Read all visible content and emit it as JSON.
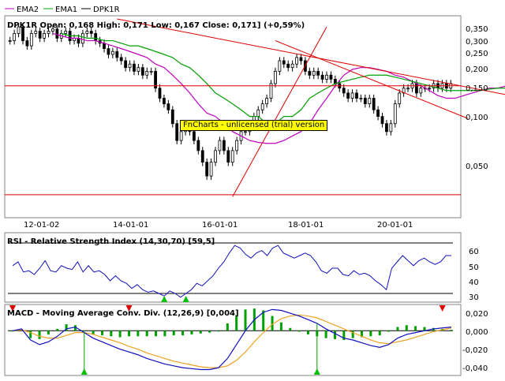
{
  "window": {
    "background": "#ffffff",
    "frame_color": "#808080"
  },
  "legend": [
    {
      "name": "EMA2",
      "color": "#c000c0"
    },
    {
      "name": "EMA1",
      "color": "#00a000"
    },
    {
      "name": "DPK1R",
      "color": "#000000"
    }
  ],
  "price_panel": {
    "header": "DPK1R  Open: 0,168  High: 0,171  Low: 0,167  Close: 0,171] (+0,59%)",
    "y_ticks": [
      "0,350",
      "0,300",
      "0,250",
      "0,200",
      "0,150",
      "0,100",
      "0,050"
    ],
    "x_ticks": [
      "12-01-02",
      "14-01-01",
      "16-01-01",
      "18-01-01",
      "20-01-01"
    ],
    "watermark": "FnCharts - unlicensed (trial) version"
  },
  "rsi_panel": {
    "title": "RSI - Relative Strength Index (14,30,70) [59,5]",
    "y_ticks": [
      "60",
      "50",
      "40",
      "30"
    ]
  },
  "macd_panel": {
    "title": "MACD - Moving Average Conv. Div. (12,26,9) [0,004]",
    "y_ticks": [
      "0,020",
      "0,000",
      "-0,020",
      "-0,040"
    ]
  },
  "chart_data": [
    {
      "type": "candlestick",
      "name": "DPK1R",
      "scale": "log",
      "ylim": [
        0.03,
        0.4
      ],
      "x_tick_labels": [
        "12-01-02",
        "14-01-01",
        "16-01-01",
        "18-01-01",
        "20-01-01"
      ],
      "x_tick_index": [
        5,
        26,
        47,
        68,
        89
      ],
      "close": [
        0.3,
        0.33,
        0.36,
        0.3,
        0.28,
        0.33,
        0.34,
        0.31,
        0.33,
        0.34,
        0.35,
        0.31,
        0.33,
        0.34,
        0.3,
        0.31,
        0.29,
        0.33,
        0.34,
        0.33,
        0.3,
        0.29,
        0.27,
        0.25,
        0.26,
        0.24,
        0.23,
        0.21,
        0.22,
        0.2,
        0.21,
        0.19,
        0.2,
        0.2,
        0.16,
        0.14,
        0.13,
        0.12,
        0.1,
        0.08,
        0.09,
        0.1,
        0.09,
        0.08,
        0.07,
        0.06,
        0.05,
        0.06,
        0.07,
        0.08,
        0.07,
        0.06,
        0.07,
        0.08,
        0.09,
        0.09,
        0.1,
        0.11,
        0.12,
        0.13,
        0.14,
        0.17,
        0.2,
        0.23,
        0.22,
        0.21,
        0.22,
        0.24,
        0.23,
        0.2,
        0.19,
        0.2,
        0.19,
        0.18,
        0.19,
        0.18,
        0.17,
        0.16,
        0.15,
        0.14,
        0.15,
        0.14,
        0.14,
        0.13,
        0.14,
        0.12,
        0.11,
        0.1,
        0.09,
        0.1,
        0.13,
        0.15,
        0.16,
        0.16,
        0.17,
        0.15,
        0.16,
        0.16,
        0.16,
        0.17,
        0.16,
        0.17,
        0.16,
        0.17
      ],
      "hlines": [
        0.165,
        0.039
      ],
      "trendlines": [
        {
          "from": [
            25,
            0.4
          ],
          "to": [
            117,
            0.145
          ]
        },
        {
          "from": [
            52,
            0.038
          ],
          "to": [
            74,
            0.36
          ]
        },
        {
          "from": [
            62,
            0.3
          ],
          "to": [
            107,
            0.107
          ]
        }
      ]
    },
    {
      "type": "line",
      "name": "EMA2",
      "scale": "log",
      "values": [
        0.33,
        0.32,
        0.31,
        0.31,
        0.3,
        0.3,
        0.29,
        0.28,
        0.27,
        0.26,
        0.25,
        0.24,
        0.22,
        0.21,
        0.19,
        0.17,
        0.15,
        0.13,
        0.115,
        0.11,
        0.1,
        0.09,
        0.085,
        0.08,
        0.078,
        0.077,
        0.077,
        0.08,
        0.085,
        0.09,
        0.1,
        0.12,
        0.14,
        0.165,
        0.19,
        0.205,
        0.21,
        0.21,
        0.205,
        0.2,
        0.19,
        0.185,
        0.175,
        0.165,
        0.155,
        0.145,
        0.14,
        0.14,
        0.145,
        0.15,
        0.155,
        0.16,
        0.16,
        0.165
      ],
      "x_start": 10,
      "x_step": 2
    },
    {
      "type": "line",
      "name": "EMA1",
      "scale": "log",
      "values": [
        0.33,
        0.32,
        0.32,
        0.31,
        0.31,
        0.3,
        0.3,
        0.29,
        0.28,
        0.28,
        0.27,
        0.26,
        0.25,
        0.24,
        0.22,
        0.21,
        0.19,
        0.17,
        0.15,
        0.14,
        0.13,
        0.12,
        0.11,
        0.11,
        0.1,
        0.1,
        0.11,
        0.11,
        0.12,
        0.14,
        0.15,
        0.16,
        0.17,
        0.175,
        0.18,
        0.185,
        0.19,
        0.19,
        0.19,
        0.185,
        0.18,
        0.175,
        0.17,
        0.165,
        0.16,
        0.155,
        0.155,
        0.155,
        0.155,
        0.155,
        0.158,
        0.16,
        0.16
      ],
      "x_start": 12,
      "x_step": 2
    },
    {
      "type": "line",
      "name": "RSI",
      "ylim": [
        25,
        75
      ],
      "levels": [
        30,
        70
      ],
      "values": [
        52,
        55,
        47,
        48,
        45,
        50,
        56,
        48,
        47,
        52,
        50,
        49,
        55,
        47,
        52,
        47,
        48,
        45,
        40,
        44,
        40,
        38,
        34,
        37,
        33,
        31,
        32,
        30,
        28,
        32,
        30,
        27,
        30,
        33,
        38,
        36,
        40,
        44,
        50,
        55,
        62,
        68,
        66,
        61,
        58,
        62,
        64,
        60,
        66,
        68,
        62,
        60,
        58,
        60,
        62,
        60,
        55,
        48,
        46,
        50,
        50,
        45,
        44,
        48,
        45,
        46,
        44,
        40,
        37,
        33,
        50,
        55,
        60,
        56,
        52,
        56,
        58,
        55,
        53,
        55,
        60,
        60
      ],
      "signals_up": [
        28,
        32
      ]
    },
    {
      "type": "bar+line",
      "name": "MACD",
      "ylim": [
        -0.045,
        0.025
      ],
      "macd": [
        0.0,
        0.002,
        -0.01,
        -0.015,
        -0.012,
        -0.006,
        0.002,
        0.004,
        -0.002,
        -0.008,
        -0.012,
        -0.016,
        -0.02,
        -0.023,
        -0.026,
        -0.03,
        -0.033,
        -0.036,
        -0.038,
        -0.04,
        -0.041,
        -0.042,
        -0.042,
        -0.04,
        -0.03,
        -0.015,
        0.0,
        0.012,
        0.02,
        0.023,
        0.022,
        0.019,
        0.016,
        0.012,
        0.008,
        0.002,
        -0.003,
        -0.008,
        -0.01,
        -0.013,
        -0.016,
        -0.018,
        -0.015,
        -0.008,
        -0.004,
        -0.002,
        0.0,
        0.002,
        0.003,
        0.004
      ],
      "signal": [
        0.0,
        0.001,
        -0.002,
        -0.006,
        -0.008,
        -0.008,
        -0.005,
        -0.002,
        -0.002,
        -0.004,
        -0.007,
        -0.01,
        -0.013,
        -0.017,
        -0.02,
        -0.024,
        -0.027,
        -0.03,
        -0.033,
        -0.035,
        -0.037,
        -0.039,
        -0.04,
        -0.04,
        -0.038,
        -0.032,
        -0.023,
        -0.012,
        -0.002,
        0.007,
        0.013,
        0.016,
        0.017,
        0.016,
        0.014,
        0.01,
        0.006,
        0.002,
        -0.002,
        -0.006,
        -0.01,
        -0.013,
        -0.014,
        -0.012,
        -0.01,
        -0.007,
        -0.004,
        -0.001,
        0.001,
        0.003
      ],
      "markers_down": [
        0,
        13,
        48
      ],
      "markers_up": [
        8,
        34,
        58
      ]
    }
  ]
}
